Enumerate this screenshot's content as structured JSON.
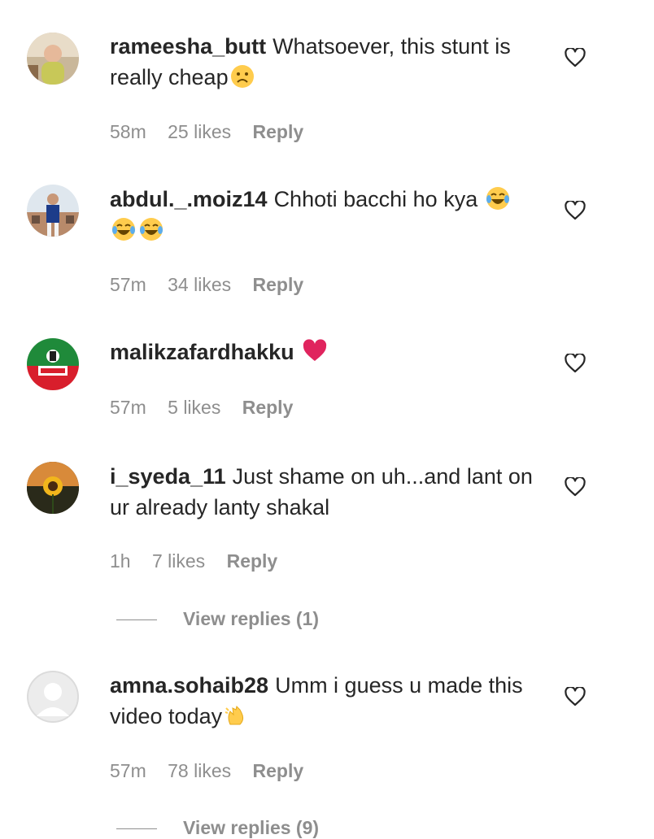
{
  "comments": [
    {
      "username": "rameesha_butt",
      "text": "Whatsoever, this stunt is really cheap",
      "time": "58m",
      "likes": "25 likes",
      "reply": "Reply",
      "avatar_icon": "baby-photo-avatar"
    },
    {
      "username": "abdul._.moiz14",
      "text": "Chhoti bacchi ho kya",
      "time": "57m",
      "likes": "34 likes",
      "reply": "Reply",
      "avatar_icon": "person-photo-avatar"
    },
    {
      "username": "malikzafardhakku",
      "text": "",
      "time": "57m",
      "likes": "5 likes",
      "reply": "Reply",
      "avatar_icon": "party-flag-avatar"
    },
    {
      "username": "i_syeda_11",
      "text": "Just shame on uh...and lant on ur already lanty shakal",
      "time": "1h",
      "likes": "7 likes",
      "reply": "Reply",
      "avatar_icon": "sunflower-avatar",
      "view_replies": "View replies (1)"
    },
    {
      "username": "amna.sohaib28",
      "text": "Umm i guess u made this video today",
      "time": "57m",
      "likes": "78 likes",
      "reply": "Reply",
      "avatar_icon": "default-avatar",
      "view_replies": "View replies (9)"
    }
  ],
  "colors": {
    "text": "#262626",
    "secondary": "#8e8e8e",
    "heart_red": "#e0245e",
    "emoji_yellow": "#ffcc4d"
  }
}
